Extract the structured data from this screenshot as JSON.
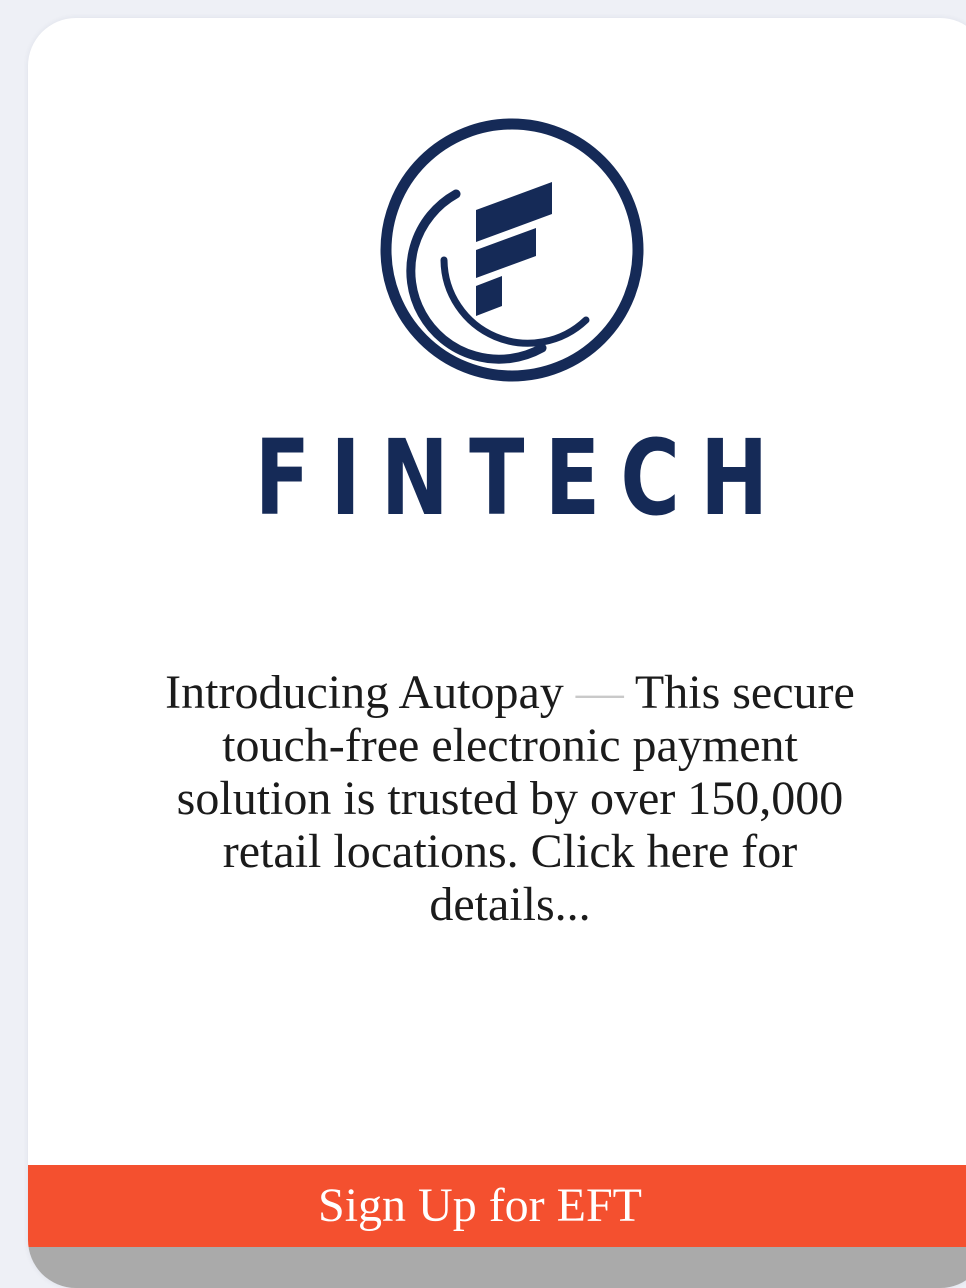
{
  "brand": {
    "name": "FINTECH",
    "logo_icon": "fintech-circle-f-logo",
    "color": "#152a57"
  },
  "promo": {
    "lead": "Introducing Autopay",
    "dash": "—",
    "body": "This secure touch-free electronic payment solution is trusted by over 150,000 retail locations. Click here for details..."
  },
  "cta": {
    "label": "Sign Up for EFT",
    "color": "#f4502f"
  }
}
